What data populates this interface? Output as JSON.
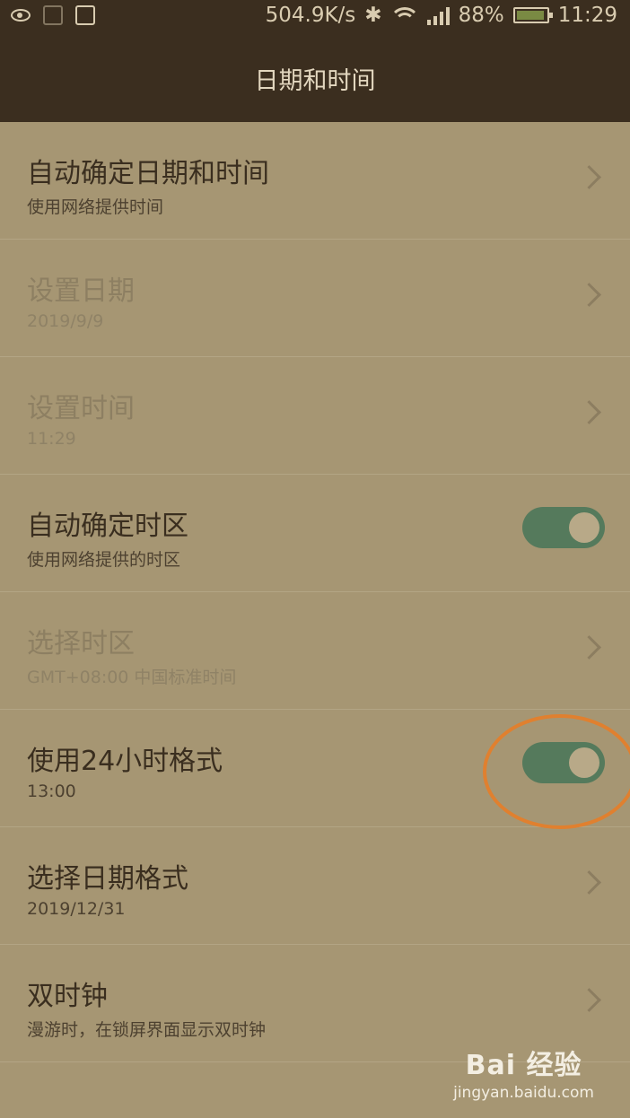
{
  "status_bar": {
    "speed": "504.9K/s",
    "battery": "88%",
    "time": "11:29"
  },
  "header": {
    "title": "日期和时间"
  },
  "settings": [
    {
      "title": "自动确定日期和时间",
      "subtitle": "使用网络提供时间",
      "control": "chevron",
      "enabled": true
    },
    {
      "title": "设置日期",
      "subtitle": "2019/9/9",
      "control": "chevron",
      "enabled": false
    },
    {
      "title": "设置时间",
      "subtitle": "11:29",
      "control": "chevron",
      "enabled": false
    },
    {
      "title": "自动确定时区",
      "subtitle": "使用网络提供的时区",
      "control": "toggle",
      "checked": true,
      "enabled": true
    },
    {
      "title": "选择时区",
      "subtitle": "GMT+08:00 中国标准时间",
      "control": "chevron",
      "enabled": false
    },
    {
      "title": "使用24小时格式",
      "subtitle": "13:00",
      "control": "toggle",
      "checked": true,
      "enabled": true
    },
    {
      "title": "选择日期格式",
      "subtitle": "2019/12/31",
      "control": "chevron",
      "enabled": true
    },
    {
      "title": "双时钟",
      "subtitle": "漫游时，在锁屏界面显示双时钟",
      "control": "chevron",
      "enabled": true
    }
  ],
  "watermark": {
    "brand": "Bai 经验",
    "url": "jingyan.baidu.com"
  },
  "colors": {
    "toggle_on": "#557a5c",
    "annotation_circle": "#e0802f",
    "header_bg": "#3b2e1f"
  }
}
